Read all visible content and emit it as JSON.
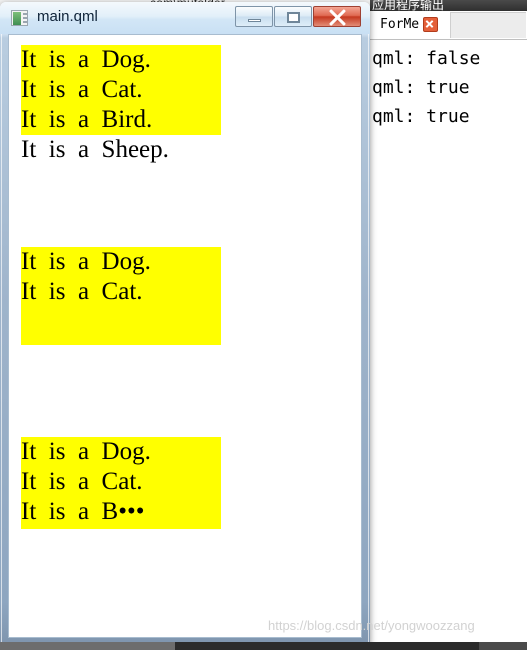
{
  "background": {
    "ide_title": "com\\mufolder",
    "ide_file_tab": "main.qml"
  },
  "qml_window": {
    "title": "main.qml",
    "icon": "app-window-icon",
    "controls": {
      "minimize": "—",
      "maximize": "□",
      "close": "✕"
    },
    "blocks": [
      {
        "id": "block-1",
        "highlighted_lines": 3,
        "lines": [
          "It  is  a  Dog.",
          "It  is  a  Cat.",
          "It  is  a  Bird.",
          "It  is  a  Sheep."
        ]
      },
      {
        "id": "block-2",
        "highlighted_lines": 2,
        "lines": [
          "It  is  a  Dog.",
          "It  is  a  Cat."
        ]
      },
      {
        "id": "block-3",
        "highlighted_lines": 3,
        "lines": [
          "It  is  a  Dog.",
          "It  is  a  Cat.",
          "It  is  a  B•••"
        ]
      }
    ]
  },
  "output_pane": {
    "header_title": "应用程序输出",
    "tab": {
      "label": "ForMe",
      "close_icon": "close-icon"
    },
    "console_lines": [
      "qml: false",
      "qml: true",
      "qml: true"
    ]
  },
  "watermark": "https://blog.csdn.net/yongwoozzang",
  "colors": {
    "highlight": "#ffff00",
    "close_button": "#c5381f",
    "tab_close": "#e4603a",
    "window_frame": "#9fb4cb"
  }
}
